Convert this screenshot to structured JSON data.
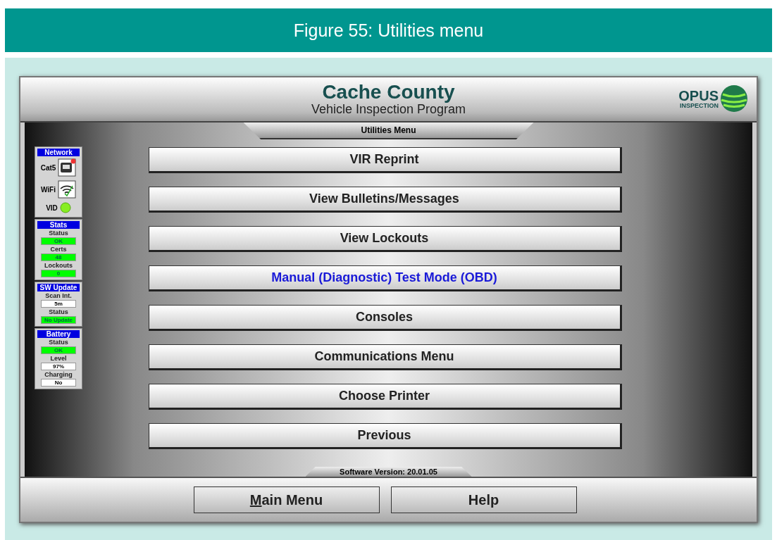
{
  "figure_caption": "Figure 55: Utilities menu",
  "header": {
    "title": "Cache County",
    "subtitle": "Vehicle Inspection Program",
    "logo_text": "OPUS",
    "logo_subtext": "INSPECTION"
  },
  "menu_title": "Utilities Menu",
  "sidebar": [
    {
      "title": "Network",
      "items": [
        {
          "kind": "ethernet",
          "label": "Cat5",
          "error": true
        },
        {
          "kind": "wifi",
          "label": "WiFi",
          "error": false
        },
        {
          "kind": "led",
          "label": "VID",
          "error": false
        }
      ]
    },
    {
      "title": "Stats",
      "items": [
        {
          "kind": "status",
          "label": "Status",
          "value": "OK"
        },
        {
          "kind": "status",
          "label": "Certs",
          "value": "48"
        },
        {
          "kind": "status",
          "label": "Lockouts",
          "value": "0"
        }
      ]
    },
    {
      "title": "SW Update",
      "items": [
        {
          "kind": "field",
          "label": "Scan Int.",
          "value": "5m"
        },
        {
          "kind": "status",
          "label": "Status",
          "value": "No Update"
        }
      ]
    },
    {
      "title": "Battery",
      "items": [
        {
          "kind": "status",
          "label": "Status",
          "value": "OK"
        },
        {
          "kind": "field",
          "label": "Level",
          "value": "97%"
        },
        {
          "kind": "field",
          "label": "Charging",
          "value": "No"
        }
      ]
    }
  ],
  "menu_buttons": [
    {
      "label": "VIR Reprint",
      "highlighted": false
    },
    {
      "label": "View Bulletins/Messages",
      "highlighted": false
    },
    {
      "label": "View Lockouts",
      "highlighted": false
    },
    {
      "label": "Manual (Diagnostic) Test Mode (OBD)",
      "highlighted": true
    },
    {
      "label": "Consoles",
      "highlighted": false
    },
    {
      "label": "Communications Menu",
      "highlighted": false
    },
    {
      "label": "Choose Printer",
      "highlighted": false
    },
    {
      "label": "Previous",
      "highlighted": false
    }
  ],
  "software_version": "Software Version: 20.01.05",
  "footer_buttons": [
    {
      "label": "Main Menu",
      "first_letter_underlined": true
    },
    {
      "label": "Help",
      "first_letter_underlined": false
    }
  ]
}
